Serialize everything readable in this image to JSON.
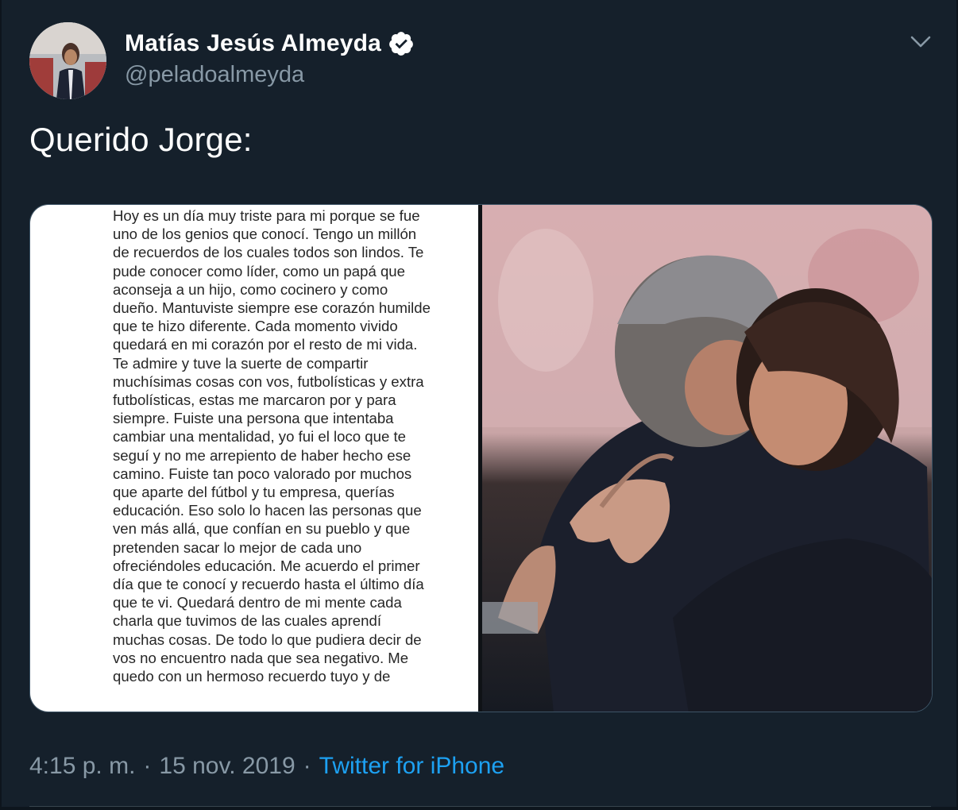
{
  "tweet": {
    "author": {
      "display_name": "Matías Jesús Almeyda",
      "handle": "@peladoalmeyda",
      "verified": true,
      "avatar_icon": "profile-photo"
    },
    "text": "Querido Jorge:",
    "media": {
      "letter_text": "Hoy es un día muy triste para mi porque se fue uno de los genios que conocí. Tengo un millón de recuerdos de los cuales todos son lindos. Te pude conocer como líder, como un papá que aconseja a un hijo, como cocinero y como dueño. Mantuviste siempre ese corazón humilde que te hizo diferente. Cada momento vivido quedará en mi corazón por el resto de mi vida. Te admire y tuve la suerte de compartir muchísimas cosas con vos, futbolísticas y extra futbolísticas, estas me marcaron por y para siempre. Fuiste una persona que intentaba cambiar una mentalidad, yo fui el loco que te seguí y no me arrepiento de haber hecho ese camino. Fuiste tan poco valorado por muchos que aparte del fútbol y tu empresa, querías educación. Eso solo lo hacen las personas que ven más allá, que confían en su pueblo y que pretenden sacar lo mejor de cada uno ofreciéndoles educación. Me acuerdo el primer día que te conocí y recuerdo hasta el último día que te vi. Quedará dentro de mi mente cada charla que tuvimos de las cuales aprendí muchas cosas. De todo lo que pudiera decir de vos no encuentro nada que sea negativo. Me quedo con un hermoso recuerdo tuyo y de",
      "photo_icon": "embrace-photo"
    },
    "time": "4:15 p. m.",
    "separator": "·",
    "date": "15 nov. 2019",
    "source": "Twitter for iPhone"
  },
  "icons": {
    "verified": "verified-badge-icon",
    "menu": "chevron-down-icon"
  },
  "colors": {
    "background": "#15202b",
    "secondary_text": "#8899a6",
    "link": "#1da1f2"
  }
}
